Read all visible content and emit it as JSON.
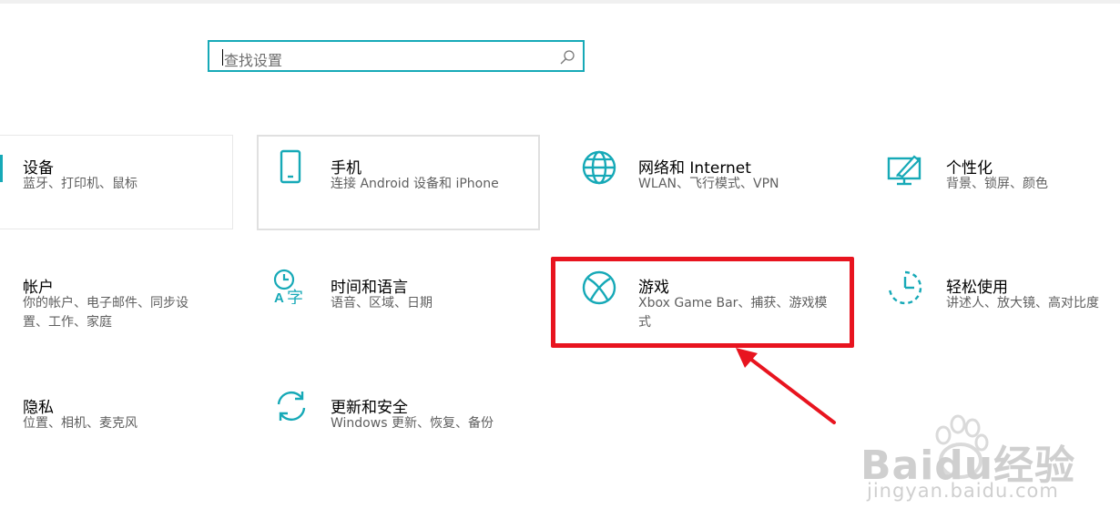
{
  "search": {
    "placeholder": "查找设置"
  },
  "tiles": [
    {
      "title": "设备",
      "desc": "蓝牙、打印机、鼠标"
    },
    {
      "title": "手机",
      "desc": "连接 Android 设备和 iPhone"
    },
    {
      "title": "网络和 Internet",
      "desc": "WLAN、飞行模式、VPN"
    },
    {
      "title": "个性化",
      "desc": "背景、锁屏、颜色"
    },
    {
      "title": "帐户",
      "desc": "你的帐户、电子邮件、同步设置、工作、家庭"
    },
    {
      "title": "时间和语言",
      "desc": "语音、区域、日期"
    },
    {
      "title": "游戏",
      "desc": "Xbox Game Bar、捕获、游戏模式"
    },
    {
      "title": "轻松使用",
      "desc": "讲述人、放大镜、高对比度"
    },
    {
      "title": "隐私",
      "desc": "位置、相机、麦克风"
    },
    {
      "title": "更新和安全",
      "desc": "Windows 更新、恢复、备份"
    }
  ],
  "watermark": {
    "main": "Baidu经验",
    "sub": "jingyan.baidu.com"
  },
  "colors": {
    "accent": "#16a9b7",
    "highlight": "#e8141f"
  }
}
